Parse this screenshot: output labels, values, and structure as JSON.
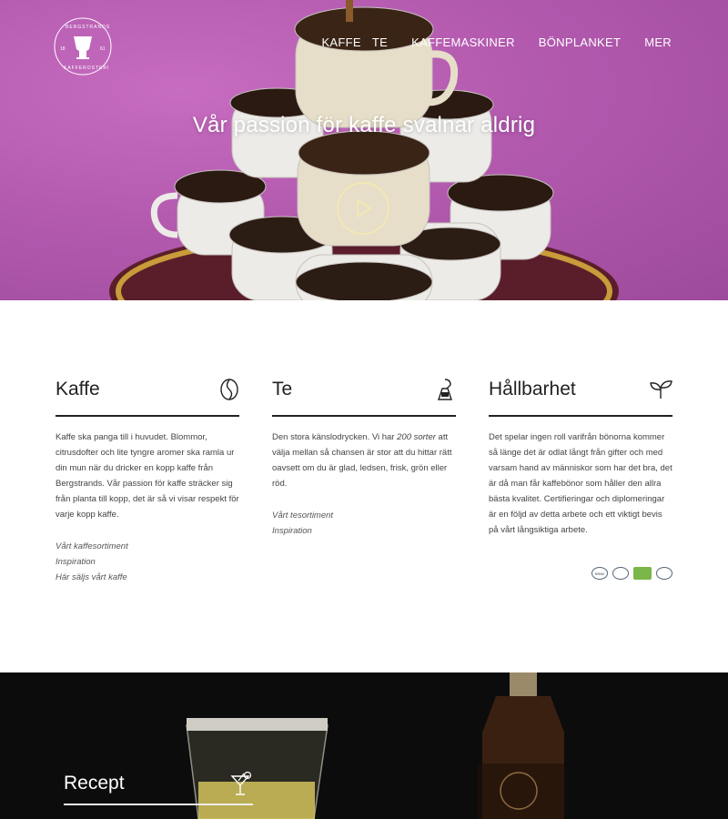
{
  "brand": {
    "logo_top": "BERGSTRANDS",
    "logo_bottom": "KAFFEROSTERI",
    "logo_left": "18",
    "logo_right": "61"
  },
  "nav": {
    "items": [
      {
        "label": "KAFFE"
      },
      {
        "label": "TE"
      },
      {
        "label": "KAFFEMASKINER"
      },
      {
        "label": "BÖNPLANKET"
      },
      {
        "label": "MER"
      }
    ]
  },
  "hero": {
    "title": "Vår passion för kaffe svalnar aldrig",
    "play_icon": "play-icon"
  },
  "columns": [
    {
      "title": "Kaffe",
      "icon": "coffee-bean-icon",
      "text": "Kaffe ska panga till i huvudet. Blommor, citrusdofter och lite tyngre aromer ska ramla ur din mun när du dricker en kopp kaffe från Bergstrands. Vår passion för kaffe sträcker sig från planta till kopp, det är så vi visar respekt för varje kopp kaffe.",
      "links": [
        "Vårt kaffesortiment",
        "Inspiration",
        "Här säljs vårt kaffe"
      ]
    },
    {
      "title": "Te",
      "icon": "tea-bag-icon",
      "text_before": "Den stora känslodrycken. Vi har ",
      "text_em": "200 sorter",
      "text_after": " att välja mellan så chansen är stor att du hittar rätt oavsett om du är glad, ledsen, frisk, grön eller röd.",
      "links": [
        "Vårt tesortiment",
        "Inspiration"
      ]
    },
    {
      "title": "Hållbarhet",
      "icon": "sprout-icon",
      "text": "Det spelar ingen roll varifrån bönorna kommer så länge det är odlat långt från gifter och med varsam hand av människor som har det bra, det är då man får kaffebönor som håller den allra bästa kvalitet. Certifieringar och diplomeringar är en följd av detta arbete och ett viktigt bevis på vårt långsiktiga arbete.",
      "certs": [
        "KRAV",
        "Rainforest Alliance",
        "EU-ekologisk",
        "Fairtrade"
      ]
    }
  ],
  "recipe": {
    "title": "Recept",
    "icon": "cocktail-glass-icon"
  }
}
